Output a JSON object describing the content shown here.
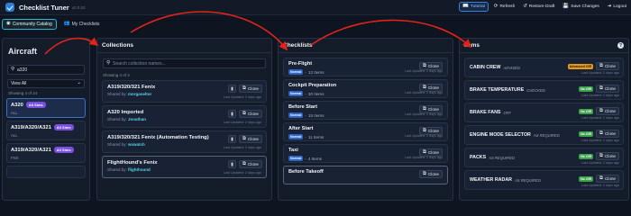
{
  "app": {
    "title": "Checklist Tuner",
    "version": "v2.0.53"
  },
  "toolbar": {
    "tutorial_label": "Tutorial",
    "refresh_label": "Refresh",
    "restore_label": "Restore Draft",
    "save_label": "Save Changes",
    "logout_label": "Logout"
  },
  "nav": {
    "community_label": "Community Catalog",
    "my_checklists_label": "My Checklists"
  },
  "aircraft": {
    "heading": "Aircraft",
    "search_value": "a320",
    "select_value": "View All",
    "count": "Showing 4 of 24",
    "items": [
      {
        "name": "A320",
        "badge": "All Sims",
        "sub": "ALL"
      },
      {
        "name": "A319/A320/A321",
        "badge": "All Sims",
        "sub": "ALL"
      },
      {
        "name": "A319/A320/A321",
        "badge": "All Sims",
        "sub": "FNX"
      },
      {
        "name": "",
        "badge": "",
        "sub": ""
      }
    ]
  },
  "collections": {
    "heading": "Collections",
    "search_placeholder": "Search collection names...",
    "count": "Showing 4 of 4",
    "shared_prefix": "Shared by:",
    "clone_label": "Clone",
    "updated": "Last Updated: 2 days ago",
    "items": [
      {
        "name": "A319/320/321 Fenix",
        "author": "morganeltor"
      },
      {
        "name": "A320 Imported",
        "author": "Jonathan"
      },
      {
        "name": "A319/320/321 Fenix (Automation Testing)",
        "author": "wxwatch"
      },
      {
        "name": "FlightHound's Fenix",
        "author": "flighthound"
      }
    ]
  },
  "checklists": {
    "heading": "Checklists",
    "badge": "Normal",
    "clone_label": "Clone",
    "updated": "Last Updated: 2 days ago",
    "items": [
      {
        "name": "Pre-Flight",
        "count": "12 Items"
      },
      {
        "name": "Cockpit Preparation",
        "count": "30 Items"
      },
      {
        "name": "Before Start",
        "count": "15 Items"
      },
      {
        "name": "After Start",
        "count": "11 Items"
      },
      {
        "name": "Taxi",
        "count": "4 Items"
      },
      {
        "name": "Before Takeoff",
        "count": ""
      }
    ]
  },
  "items_panel": {
    "heading": "Items",
    "clone_label": "Clone",
    "updated": "Last Updated: 2 days ago",
    "items": [
      {
        "name": "CABIN CREW",
        "state": "ADVISED",
        "pill": "Advanced CIR",
        "pill_type": "adv"
      },
      {
        "name": "BRAKE TEMPERATURE",
        "state": "CHECKED",
        "pill": "No CIR",
        "pill_type": "nochk"
      },
      {
        "name": "BRAKE FANS",
        "state": "OFF",
        "pill": "No CIR",
        "pill_type": "nochk"
      },
      {
        "name": "ENGINE MODE SELECTOR",
        "state": "AS REQUIRED",
        "pill": "No CIR",
        "pill_type": "nochk"
      },
      {
        "name": "PACKS",
        "state": "AS REQUIRED",
        "pill": "No CIR",
        "pill_type": "nochk"
      },
      {
        "name": "WEATHER RADAR",
        "state": "AS REQUIRED",
        "pill": "No CIR",
        "pill_type": "nochk"
      }
    ]
  },
  "colors": {
    "accent": "#3f7fd8",
    "arrow": "#e0241b",
    "author": "#58d3ea",
    "sims_badge": "#7b4fe0"
  }
}
